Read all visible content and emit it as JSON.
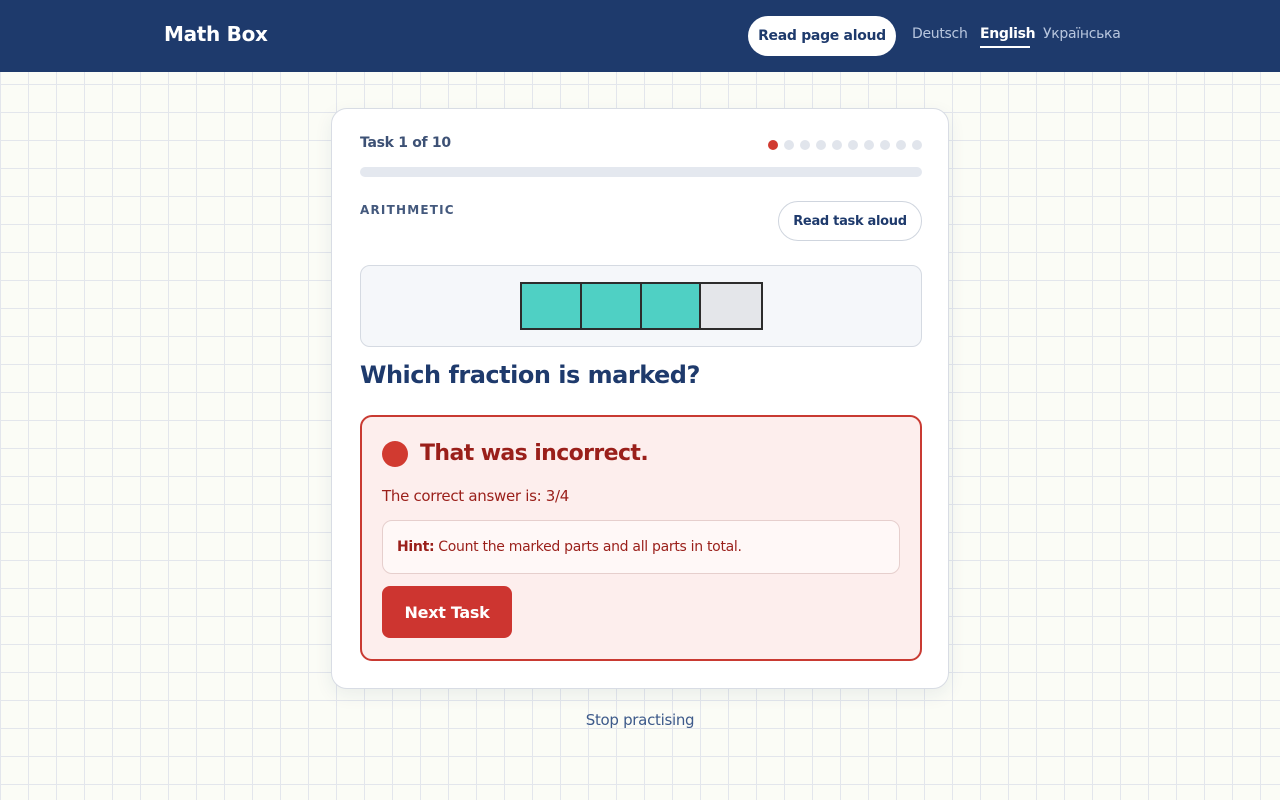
{
  "header": {
    "brand": "Math Box",
    "read_page_label": "Read page aloud",
    "languages": [
      "Deutsch",
      "English",
      "Українська"
    ],
    "active_language": "English"
  },
  "task": {
    "counter": "Task 1 of 10",
    "current": 1,
    "total": 10,
    "progress_fraction": 0,
    "category": "ARITHMETIC",
    "read_task_label": "Read task aloud",
    "figure": {
      "parts_total": 4,
      "parts_marked": 3
    },
    "question": "Which fraction is marked?"
  },
  "feedback": {
    "title": "That was incorrect.",
    "answer": "The correct answer is: 3/4",
    "hint_label": "Hint:",
    "hint_text": "Count the marked parts and all parts in total.",
    "next_label": "Next Task"
  },
  "footer": {
    "stop_label": "Stop practising"
  },
  "colors": {
    "header_bg": "#1e3a6c",
    "marked": "#4fd0c4",
    "unmarked": "#e4e6ea",
    "error": "#d13a30",
    "error_bg": "#fdeeed"
  }
}
